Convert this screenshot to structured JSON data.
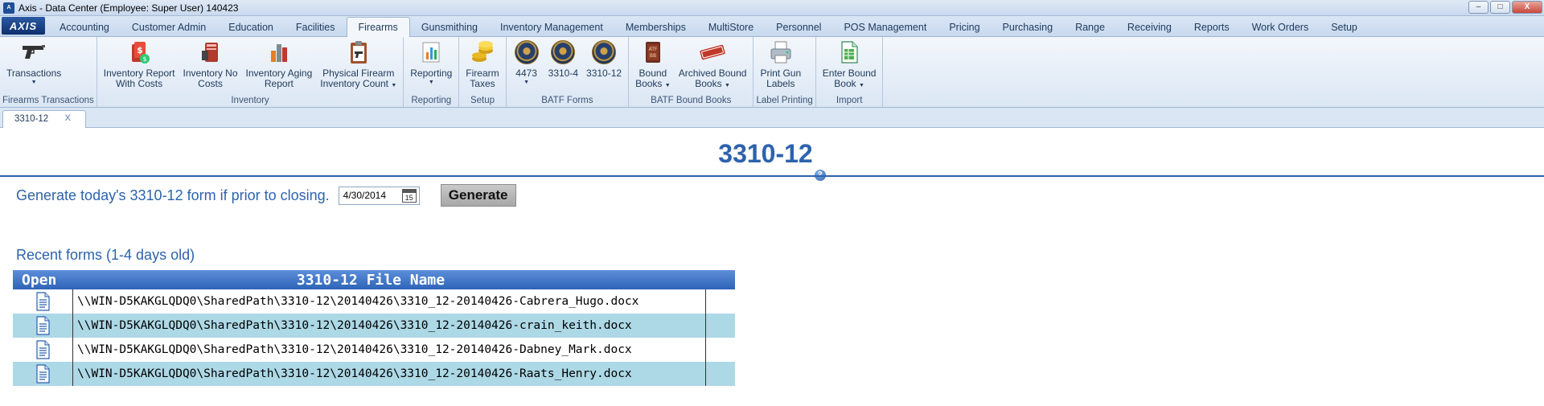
{
  "window": {
    "title": "Axis - Data Center  (Employee: Super User) 140423",
    "logo_text": "AXIS",
    "minimize": "–",
    "maximize": "□",
    "close": "X"
  },
  "menu": {
    "tabs": [
      "Accounting",
      "Customer Admin",
      "Education",
      "Facilities",
      "Firearms",
      "Gunsmithing",
      "Inventory Management",
      "Memberships",
      "MultiStore",
      "Personnel",
      "POS Management",
      "Pricing",
      "Purchasing",
      "Range",
      "Receiving",
      "Reports",
      "Work Orders",
      "Setup"
    ],
    "active": "Firearms"
  },
  "ribbon": {
    "groups": [
      {
        "label": "Firearms Transactions",
        "buttons": [
          {
            "line1": "Transactions",
            "line2": "",
            "icon": "pistol-icon",
            "dropdown": true
          }
        ]
      },
      {
        "label": "Inventory",
        "buttons": [
          {
            "line1": "Inventory Report",
            "line2": "With Costs",
            "icon": "report-dollar-icon",
            "dropdown": false
          },
          {
            "line1": "Inventory No",
            "line2": "Costs",
            "icon": "report-book-icon",
            "dropdown": false
          },
          {
            "line1": "Inventory Aging",
            "line2": "Report",
            "icon": "bar-chart-icon",
            "dropdown": false
          },
          {
            "line1": "Physical Firearm",
            "line2": "Inventory Count",
            "icon": "clipboard-gun-icon",
            "dropdown": true
          }
        ]
      },
      {
        "label": "Reporting",
        "buttons": [
          {
            "line1": "Reporting",
            "line2": "",
            "icon": "chart-report-icon",
            "dropdown": true
          }
        ]
      },
      {
        "label": "Setup",
        "buttons": [
          {
            "line1": "Firearm",
            "line2": "Taxes",
            "icon": "coins-icon",
            "dropdown": false
          }
        ]
      },
      {
        "label": "BATF Forms",
        "buttons": [
          {
            "line1": "4473",
            "line2": "",
            "icon": "batf-seal-icon",
            "dropdown": true
          },
          {
            "line1": "3310-4",
            "line2": "",
            "icon": "batf-seal-icon",
            "dropdown": false
          },
          {
            "line1": "3310-12",
            "line2": "",
            "icon": "batf-seal-icon",
            "dropdown": false
          }
        ]
      },
      {
        "label": "BATF Bound Books",
        "buttons": [
          {
            "line1": "Bound",
            "line2": "Books",
            "icon": "bound-book-icon",
            "dropdown": true
          },
          {
            "line1": "Archived Bound",
            "line2": "Books",
            "icon": "archived-stamp-icon",
            "dropdown": true
          }
        ]
      },
      {
        "label": "Label Printing",
        "buttons": [
          {
            "line1": "Print Gun",
            "line2": "Labels",
            "icon": "printer-icon",
            "dropdown": false
          }
        ]
      },
      {
        "label": "Import",
        "buttons": [
          {
            "line1": "Enter Bound",
            "line2": "Book",
            "icon": "spreadsheet-icon",
            "dropdown": true
          }
        ]
      }
    ]
  },
  "doc_tab": {
    "label": "3310-12",
    "close": "X"
  },
  "page": {
    "title": "3310-12",
    "generate_prompt": "Generate today's 3310-12 form if prior to closing.",
    "date_value": "4/30/2014",
    "calendar_day": "15",
    "generate_label": "Generate",
    "recent_label": "Recent forms (1-4 days old)"
  },
  "grid": {
    "columns": [
      "Open",
      "3310-12 File Name"
    ],
    "rows": [
      "\\\\WIN-D5KAKGLQDQ0\\SharedPath\\3310-12\\20140426\\3310_12-20140426-Cabrera_Hugo.docx",
      "\\\\WIN-D5KAKGLQDQ0\\SharedPath\\3310-12\\20140426\\3310_12-20140426-crain_keith.docx",
      "\\\\WIN-D5KAKGLQDQ0\\SharedPath\\3310-12\\20140426\\3310_12-20140426-Dabney_Mark.docx",
      "\\\\WIN-D5KAKGLQDQ0\\SharedPath\\3310-12\\20140426\\3310_12-20140426-Raats_Henry.docx"
    ]
  },
  "colors": {
    "accent": "#2d62ad",
    "row_alt": "#add8e6",
    "header": "#3a6fc2"
  }
}
